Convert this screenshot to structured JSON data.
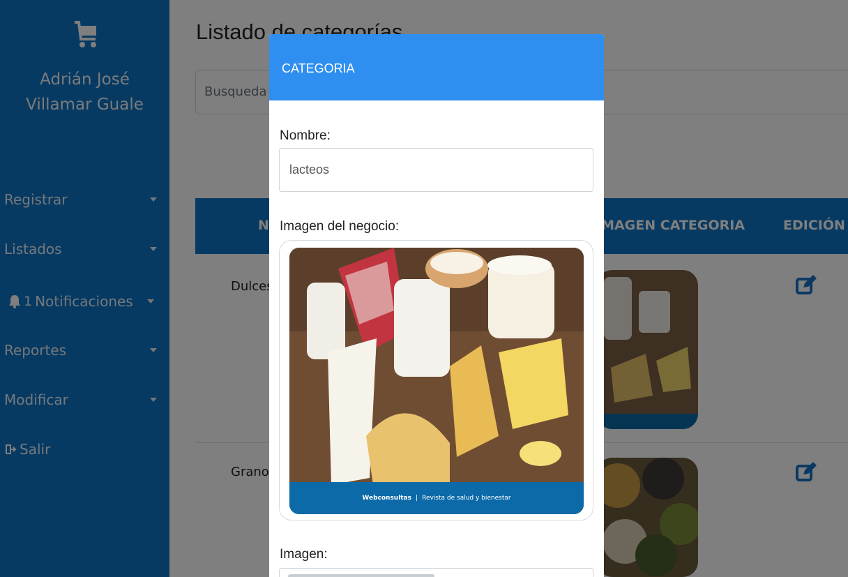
{
  "sidebar": {
    "user_name_line1": "Adrián José",
    "user_name_line2": "Villamar Guale",
    "items": [
      {
        "label": "Registrar"
      },
      {
        "label": "Listados"
      },
      {
        "label": "Notificaciones",
        "badge": "1"
      },
      {
        "label": "Reportes"
      },
      {
        "label": "Modificar"
      },
      {
        "label": "Salir"
      }
    ]
  },
  "main": {
    "title": "Listado de categorías",
    "search_placeholder": "Busqueda",
    "table": {
      "headers": [
        "NOMBRE",
        "IMAGEN CATEGORIA",
        "EDICIÓN"
      ],
      "rows": [
        {
          "name": "Dulces"
        },
        {
          "name": "Granos"
        }
      ]
    }
  },
  "modal": {
    "title": "CATEGORIA",
    "name_label": "Nombre:",
    "name_value": "lacteos",
    "image_label": "Imagen del negocio:",
    "image_caption_brand": "Webconsultas",
    "image_caption_text": "Revista de salud y bienestar",
    "file_label": "Imagen:"
  },
  "colors": {
    "sidebar": "#0f75c4",
    "table_header": "#0f75c4",
    "modal_header": "#2e8ff0"
  }
}
